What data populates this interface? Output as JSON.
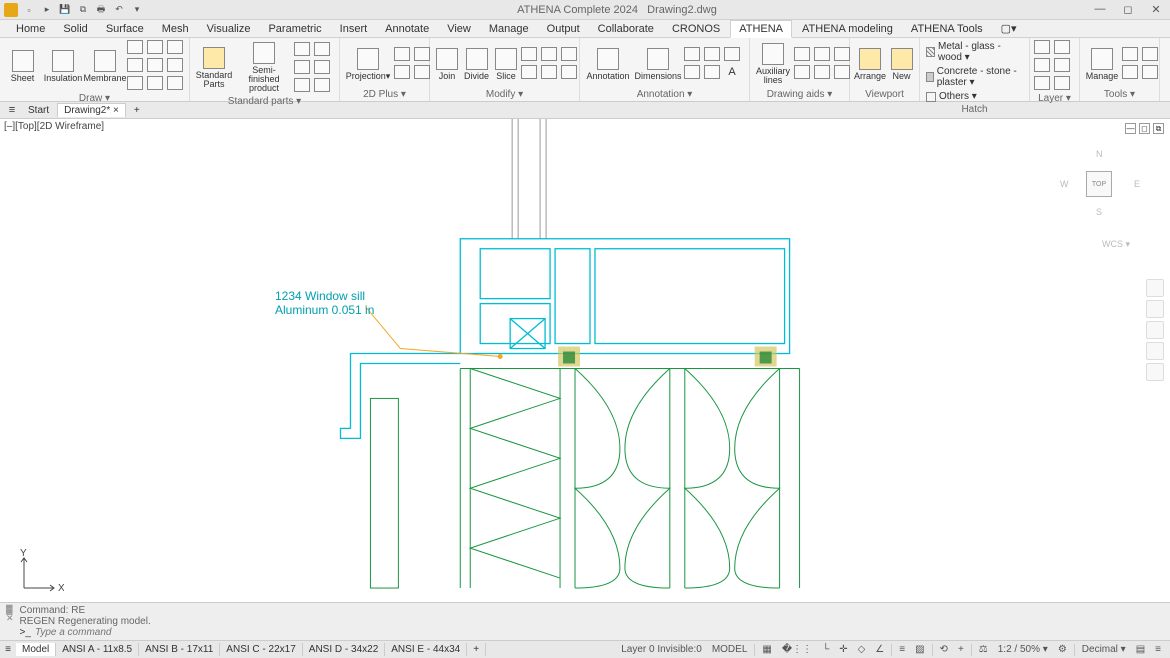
{
  "title": {
    "app": "ATHENA Complete 2024",
    "doc": "Drawing2.dwg"
  },
  "ribbonTabs": [
    "Home",
    "Solid",
    "Surface",
    "Mesh",
    "Visualize",
    "Parametric",
    "Insert",
    "Annotate",
    "View",
    "Manage",
    "Output",
    "Collaborate",
    "CRONOS",
    "ATHENA",
    "ATHENA modeling",
    "ATHENA Tools"
  ],
  "activeRibbonTab": "ATHENA",
  "panels": {
    "draw": {
      "label": "Draw ▾",
      "items": [
        "Sheet",
        "Insulation",
        "Membrane"
      ]
    },
    "stdparts": {
      "label": "Standard parts ▾",
      "items": [
        "Standard Parts",
        "Semi-finished product"
      ]
    },
    "plus2d": {
      "label": "2D Plus ▾",
      "items": [
        "Projection▾"
      ]
    },
    "modify": {
      "label": "Modify ▾",
      "items": [
        "Join",
        "Divide",
        "Slice"
      ]
    },
    "annotation": {
      "label": "Annotation ▾",
      "items": [
        "Annotation",
        "Dimensions"
      ]
    },
    "drawingaids": {
      "label": "Drawing aids ▾",
      "items": [
        "Auxiliary lines"
      ]
    },
    "viewport": {
      "label": "Viewport",
      "items": [
        "Arrange",
        "New"
      ]
    },
    "hatch": {
      "label": "Hatch",
      "items": [
        "Metal - glass - wood ▾",
        "Concrete - stone - plaster ▾",
        "Others ▾"
      ]
    },
    "layer": {
      "label": "Layer ▾"
    },
    "tools": {
      "label": "Tools ▾",
      "items": [
        "Manage"
      ]
    }
  },
  "docTabs": {
    "start": "Start",
    "active": "Drawing2*"
  },
  "viewportLabel": "[–][Top][2D Wireframe]",
  "viewcube": {
    "top": "TOP",
    "n": "N",
    "s": "S",
    "e": "E",
    "w": "W",
    "wcs": "WCS ▾"
  },
  "annotationText": {
    "line1": "1234 Window sill",
    "line2": "Aluminum 0.051 in"
  },
  "ucs": {
    "x": "X",
    "y": "Y"
  },
  "command": {
    "hist1": "Command: RE",
    "hist2": "REGEN Regenerating model.",
    "placeholder": "Type a command",
    "prompt": ">_"
  },
  "layoutTabs": [
    "Model",
    "ANSI A - 11x8.5",
    "ANSI B - 17x11",
    "ANSI C - 22x17",
    "ANSI D - 34x22",
    "ANSI E - 44x34"
  ],
  "status": {
    "layer": "Layer 0 Invisible:0",
    "space": "MODEL",
    "scale": "1:2 / 50% ▾",
    "units": "Decimal ▾"
  }
}
